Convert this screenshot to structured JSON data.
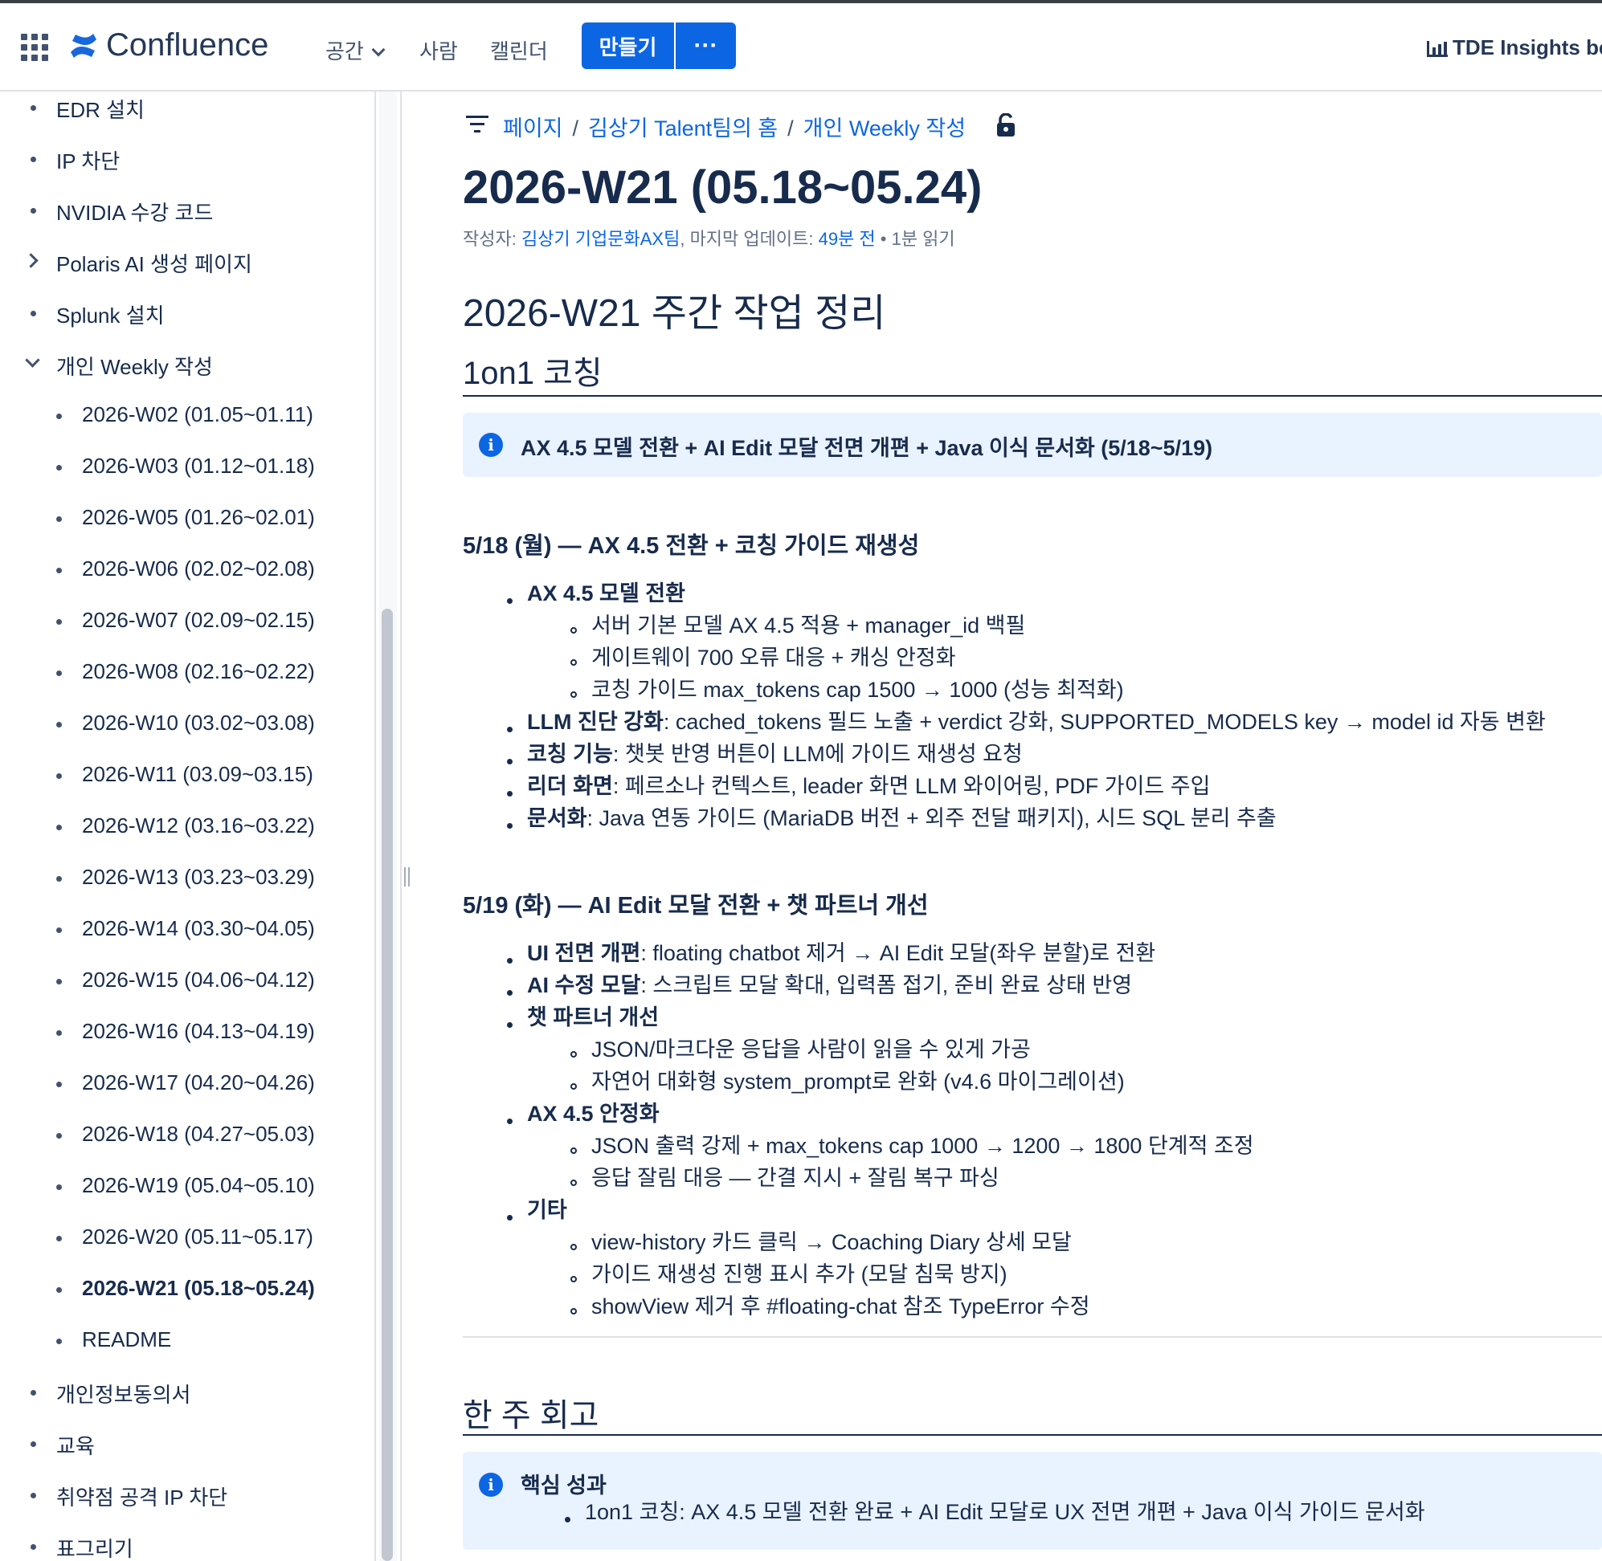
{
  "topnav": {
    "app_name": "Confluence",
    "spaces_label": "공간",
    "people_label": "사람",
    "calendar_label": "캘린더",
    "create_label": "만들기",
    "more_label": "···",
    "insights_label": "TDE Insights be"
  },
  "sidebar": {
    "top_items": [
      {
        "label": "EDR 설치"
      },
      {
        "label": "IP 차단"
      },
      {
        "label": "NVIDIA 수강 코드"
      },
      {
        "label": "Polaris AI 생성 페이지"
      },
      {
        "label": "Splunk 설치"
      },
      {
        "label": "개인 Weekly 작성"
      }
    ],
    "weekly_items": [
      {
        "label": "2026-W02 (01.05~01.11)"
      },
      {
        "label": "2026-W03 (01.12~01.18)"
      },
      {
        "label": "2026-W05 (01.26~02.01)"
      },
      {
        "label": "2026-W06 (02.02~02.08)"
      },
      {
        "label": "2026-W07 (02.09~02.15)"
      },
      {
        "label": "2026-W08 (02.16~02.22)"
      },
      {
        "label": "2026-W10 (03.02~03.08)"
      },
      {
        "label": "2026-W11 (03.09~03.15)"
      },
      {
        "label": "2026-W12 (03.16~03.22)"
      },
      {
        "label": "2026-W13 (03.23~03.29)"
      },
      {
        "label": "2026-W14 (03.30~04.05)"
      },
      {
        "label": "2026-W15 (04.06~04.12)"
      },
      {
        "label": "2026-W16 (04.13~04.19)"
      },
      {
        "label": "2026-W17 (04.20~04.26)"
      },
      {
        "label": "2026-W18 (04.27~05.03)"
      },
      {
        "label": "2026-W19 (05.04~05.10)"
      },
      {
        "label": "2026-W20 (05.11~05.17)"
      },
      {
        "label": "2026-W21 (05.18~05.24)",
        "current": true
      },
      {
        "label": "README"
      }
    ],
    "bottom_items": [
      {
        "label": "개인정보동의서"
      },
      {
        "label": "교육"
      },
      {
        "label": "취약점 공격 IP 차단"
      },
      {
        "label": "표그리기"
      }
    ]
  },
  "breadcrumb": {
    "items": [
      "페이지",
      "김상기 Talent팀의 홈",
      "개인 Weekly 작성"
    ],
    "separator": "/"
  },
  "page": {
    "title": "2026-W21 (05.18~05.24)",
    "byline": {
      "author_prefix": "작성자: ",
      "author": "김상기 기업문화AX팀",
      "updated_prefix": ", 마지막 업데이트: ",
      "updated": "49분 전",
      "read_time": " • 1분 읽기"
    },
    "h1": "2026-W21 주간 작업 정리",
    "section1": {
      "heading": "1on1 코칭",
      "panel": "AX 4.5 모델 전환 + AI Edit 모달 전면 개편 + Java 이식 문서화 (5/18~5/19)",
      "day1": {
        "heading": "5/18 (월) — AX 4.5 전환 + 코칭 가이드 재생성",
        "items": [
          {
            "bold": "AX 4.5 모델 전환",
            "text": ""
          },
          {
            "sub": "서버 기본 모델 AX 4.5 적용 + manager_id 백필"
          },
          {
            "sub": "게이트웨이 700 오류 대응 + 캐싱 안정화"
          },
          {
            "sub": "코칭 가이드 max_tokens cap 1500 → 1000 (성능 최적화)"
          },
          {
            "bold": "LLM 진단 강화",
            "text": ": cached_tokens 필드 노출 + verdict 강화, SUPPORTED_MODELS key → model id 자동 변환"
          },
          {
            "bold": "코칭 기능",
            "text": ": 챗봇 반영 버튼이 LLM에 가이드 재생성 요청"
          },
          {
            "bold": "리더 화면",
            "text": ": 페르소나 컨텍스트, leader 화면 LLM 와이어링, PDF 가이드 주입"
          },
          {
            "bold": "문서화",
            "text": ": Java 연동 가이드 (MariaDB 버전 + 외주 전달 패키지), 시드 SQL 분리 추출"
          }
        ]
      },
      "day2": {
        "heading": "5/19 (화) — AI Edit 모달 전환 + 챗 파트너 개선",
        "items": [
          {
            "bold": "UI 전면 개편",
            "text": ": floating chatbot 제거 → AI Edit 모달(좌우 분할)로 전환"
          },
          {
            "bold": "AI 수정 모달",
            "text": ": 스크립트 모달 확대, 입력폼 접기, 준비 완료 상태 반영"
          },
          {
            "bold": "챗 파트너 개선",
            "text": ""
          },
          {
            "sub": "JSON/마크다운 응답을 사람이 읽을 수 있게 가공"
          },
          {
            "sub": "자연어 대화형 system_prompt로 완화 (v4.6 마이그레이션)"
          },
          {
            "bold": "AX 4.5 안정화",
            "text": ""
          },
          {
            "sub": "JSON 출력 강제 + max_tokens cap 1000 → 1200 → 1800 단계적 조정"
          },
          {
            "sub": "응답 잘림 대응 — 간결 지시 + 잘림 복구 파싱"
          },
          {
            "bold": "기타",
            "text": ""
          },
          {
            "sub": "view-history 카드 클릭 → Coaching Diary 상세 모달"
          },
          {
            "sub": "가이드 재생성 진행 표시 추가 (모달 침묵 방지)"
          },
          {
            "sub": "showView 제거 후 #floating-chat 참조 TypeError 수정"
          }
        ]
      }
    },
    "section2": {
      "heading": "한 주 회고",
      "panel_title": "핵심 성과",
      "panel_item": "1on1 코칭: AX 4.5 모델 전환 완료 + AI Edit 모달로 UX 전면 개편 + Java 이식 가이드 문서화"
    }
  },
  "colors": {
    "accent": "#0c66e4",
    "text": "#172b4d",
    "panel_bg": "#e9f2ff",
    "muted": "#626f86"
  },
  "icons": [
    "app-switcher-icon",
    "confluence-logo-icon",
    "chevron-down-icon",
    "bar-chart-icon",
    "filter-icon",
    "unlock-icon",
    "info-icon"
  ]
}
